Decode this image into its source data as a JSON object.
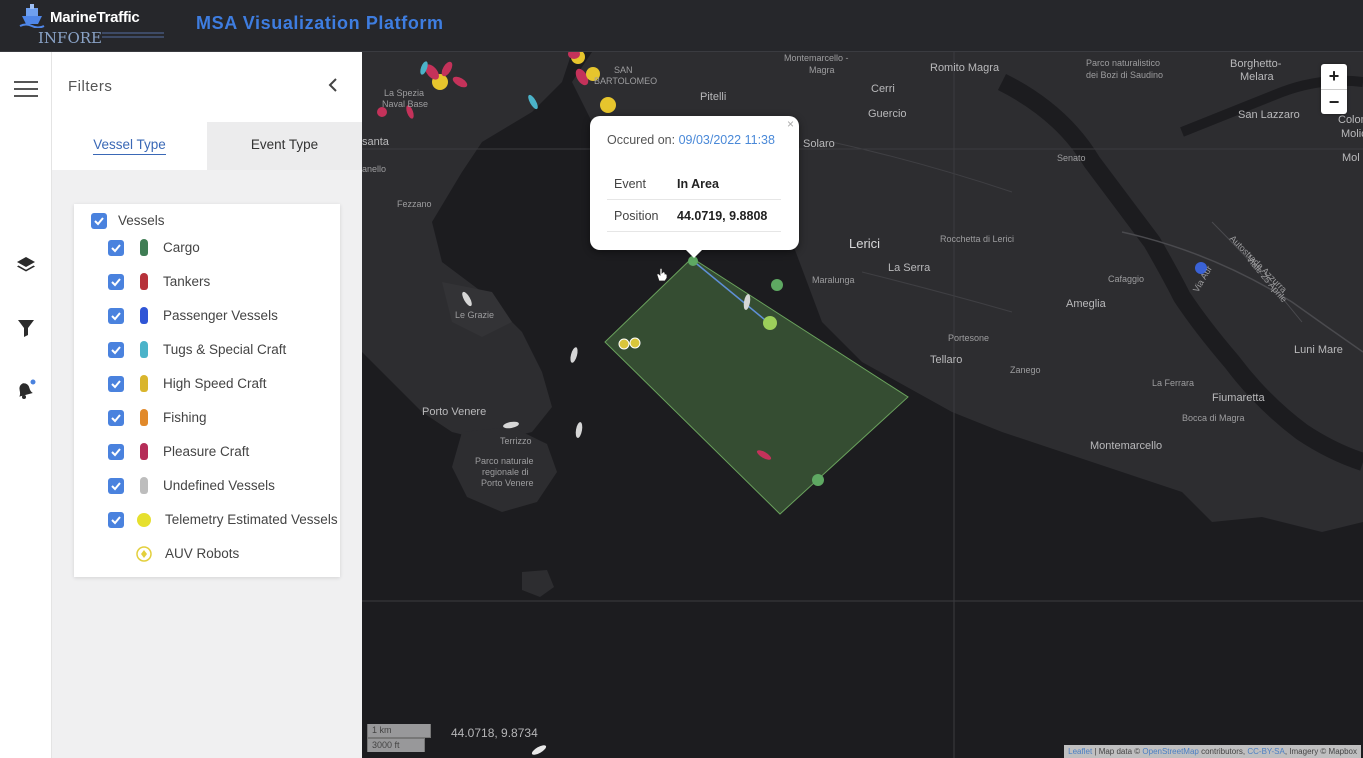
{
  "header": {
    "brand": "MarineTraffic",
    "sub_brand": "INFORE",
    "title": "MSA Visualization Platform"
  },
  "rail": {
    "items": [
      "menu-icon",
      "layers-icon",
      "filter-icon",
      "alert-bell-icon"
    ]
  },
  "filters": {
    "title": "Filters",
    "collapse_glyph": "‹",
    "tabs": [
      {
        "label": "Vessel Type",
        "active": true
      },
      {
        "label": "Event Type",
        "active": false
      }
    ],
    "group_label": "Vessels",
    "items": [
      {
        "label": "Cargo",
        "color": "#3f7d54",
        "checked": true
      },
      {
        "label": "Tankers",
        "color": "#b7323a",
        "checked": true
      },
      {
        "label": "Passenger Vessels",
        "color": "#2f55d6",
        "checked": true
      },
      {
        "label": "Tugs & Special Craft",
        "color": "#4bb3c9",
        "checked": true
      },
      {
        "label": "High Speed Craft",
        "color": "#d9b52d",
        "checked": true
      },
      {
        "label": "Fishing",
        "color": "#e1892a",
        "checked": true
      },
      {
        "label": "Pleasure Craft",
        "color": "#b52d58",
        "checked": true
      },
      {
        "label": "Undefined Vessels",
        "color": "#bdbdbd",
        "checked": true
      },
      {
        "label": "Telemetry Estimated Vessels",
        "color": "#e6e02e",
        "checked": true
      },
      {
        "label": "AUV Robots",
        "color": "#e3cf3c",
        "checked": false
      }
    ]
  },
  "map": {
    "places": [
      {
        "name": "Montemarcello -",
        "cls": "sm"
      },
      {
        "name": "Magra",
        "cls": "sm"
      },
      {
        "name": "Romito Magra",
        "cls": ""
      },
      {
        "name": "Parco naturalistico",
        "cls": "sm"
      },
      {
        "name": "dei Bozi di Saudino",
        "cls": "sm"
      },
      {
        "name": "Borghetto-",
        "cls": ""
      },
      {
        "name": "Melara",
        "cls": ""
      },
      {
        "name": "SAN",
        "cls": "sm"
      },
      {
        "name": "BARTOLOMEO",
        "cls": "sm"
      },
      {
        "name": "La Spezia",
        "cls": "sm"
      },
      {
        "name": "Naval Base",
        "cls": "sm"
      },
      {
        "name": "Pitelli",
        "cls": ""
      },
      {
        "name": "Cerri",
        "cls": ""
      },
      {
        "name": "Guercio",
        "cls": ""
      },
      {
        "name": "San Lazzaro",
        "cls": ""
      },
      {
        "name": "Colomb",
        "cls": ""
      },
      {
        "name": "Molicc",
        "cls": ""
      },
      {
        "name": "Solaro",
        "cls": ""
      },
      {
        "name": "Senato",
        "cls": "sm"
      },
      {
        "name": "Mol",
        "cls": ""
      },
      {
        "name": "santa",
        "cls": ""
      },
      {
        "name": "anello",
        "cls": "sm"
      },
      {
        "name": "Fezzano",
        "cls": "sm"
      },
      {
        "name": "Lerici",
        "cls": "big"
      },
      {
        "name": "Rocchetta di Lerici",
        "cls": "sm"
      },
      {
        "name": "La Serra",
        "cls": ""
      },
      {
        "name": "Maralunga",
        "cls": "sm"
      },
      {
        "name": "Cafaggio",
        "cls": "sm"
      },
      {
        "name": "Ameglia",
        "cls": ""
      },
      {
        "name": "Le Grazie",
        "cls": "sm"
      },
      {
        "name": "Portesone",
        "cls": "sm"
      },
      {
        "name": "Tellaro",
        "cls": ""
      },
      {
        "name": "Zanego",
        "cls": "sm"
      },
      {
        "name": "Luni Mare",
        "cls": ""
      },
      {
        "name": "La Ferrara",
        "cls": "sm"
      },
      {
        "name": "Fiumaretta",
        "cls": ""
      },
      {
        "name": "Bocca di Magra",
        "cls": "sm"
      },
      {
        "name": "Porto Venere",
        "cls": ""
      },
      {
        "name": "Terrizzo",
        "cls": "sm"
      },
      {
        "name": "Parco naturale",
        "cls": "sm"
      },
      {
        "name": "regionale di",
        "cls": "sm"
      },
      {
        "name": "Porto Venere",
        "cls": "sm"
      },
      {
        "name": "Montemarcello",
        "cls": ""
      },
      {
        "name": "Viale 25 Aprile",
        "cls": "sm"
      },
      {
        "name": "Autostrada Azzurra",
        "cls": "sm"
      },
      {
        "name": "Via Aur",
        "cls": "sm"
      }
    ],
    "popup": {
      "close_glyph": "×",
      "date_label": "Occured on:",
      "date_value": "09/03/2022 11:38",
      "rows": [
        {
          "key": "Event",
          "value": "In Area"
        },
        {
          "key": "Position",
          "value": "44.0719, 9.8808"
        }
      ]
    },
    "zoom_in": "+",
    "zoom_out": "−",
    "scale_km": "1 km",
    "scale_ft": "3000 ft",
    "cursor_coords": "44.0718, 9.8734",
    "attribution": {
      "leaflet": "Leaflet",
      "sep1": " | Map data © ",
      "osm": "OpenStreetMap",
      "mid": " contributors, ",
      "license": "CC-BY-SA",
      "end": ", Imagery © Mapbox"
    }
  }
}
